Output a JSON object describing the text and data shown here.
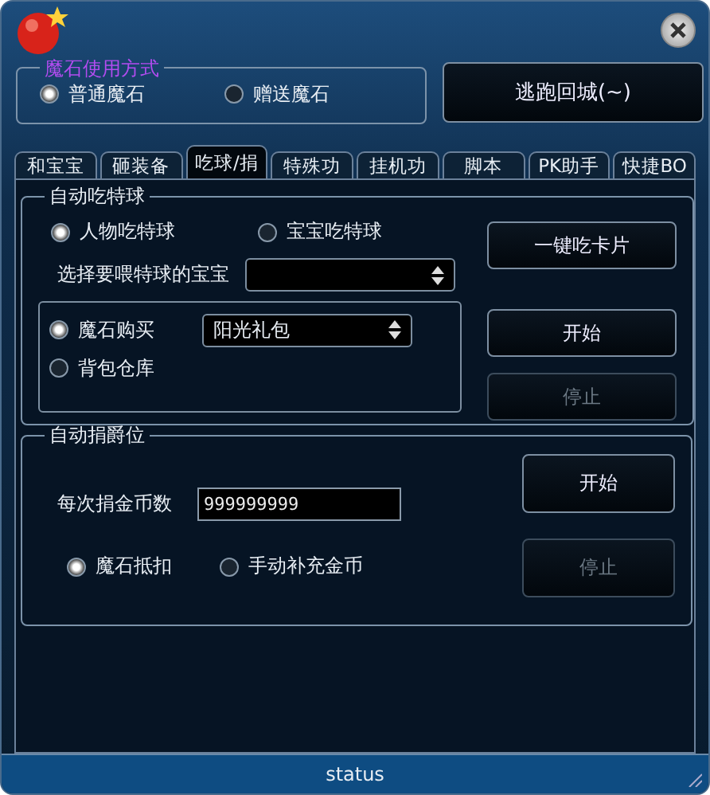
{
  "stone_mode": {
    "title": "魔石使用方式",
    "options": [
      {
        "label": "普通魔石",
        "selected": true
      },
      {
        "label": "赠送魔石",
        "selected": false
      }
    ]
  },
  "escape_button": "逃跑回城(~)",
  "tabs": [
    {
      "label": "和宝宝",
      "selected": false
    },
    {
      "label": "砸装备",
      "selected": false
    },
    {
      "label": "吃球/捐",
      "selected": true
    },
    {
      "label": "特殊功",
      "selected": false
    },
    {
      "label": "挂机功",
      "selected": false
    },
    {
      "label": "脚本",
      "selected": false
    },
    {
      "label": "PK助手",
      "selected": false
    },
    {
      "label": "快捷BO",
      "selected": false
    }
  ],
  "auto_eat": {
    "title": "自动吃特球",
    "targets": [
      {
        "label": "人物吃特球",
        "selected": true
      },
      {
        "label": "宝宝吃特球",
        "selected": false
      }
    ],
    "pet_select": {
      "label": "选择要喂特球的宝宝"
    },
    "sources": [
      {
        "label": "魔石购买",
        "selected": true,
        "select_value": "阳光礼包"
      },
      {
        "label": "背包仓库",
        "selected": false
      }
    ],
    "buttons": [
      {
        "label": "一键吃卡片",
        "disabled": false
      },
      {
        "label": "开始",
        "disabled": false
      },
      {
        "label": "停止",
        "disabled": true
      }
    ]
  },
  "auto_donate": {
    "title": "自动捐爵位",
    "amount_label": "每次捐金币数",
    "amount_value": "999999999",
    "payments": [
      {
        "label": "魔石抵扣",
        "selected": true
      },
      {
        "label": "手动补充金币",
        "selected": false
      }
    ],
    "buttons": [
      {
        "label": "开始",
        "disabled": false
      },
      {
        "label": "停止",
        "disabled": true
      }
    ]
  },
  "status_bar": "status"
}
